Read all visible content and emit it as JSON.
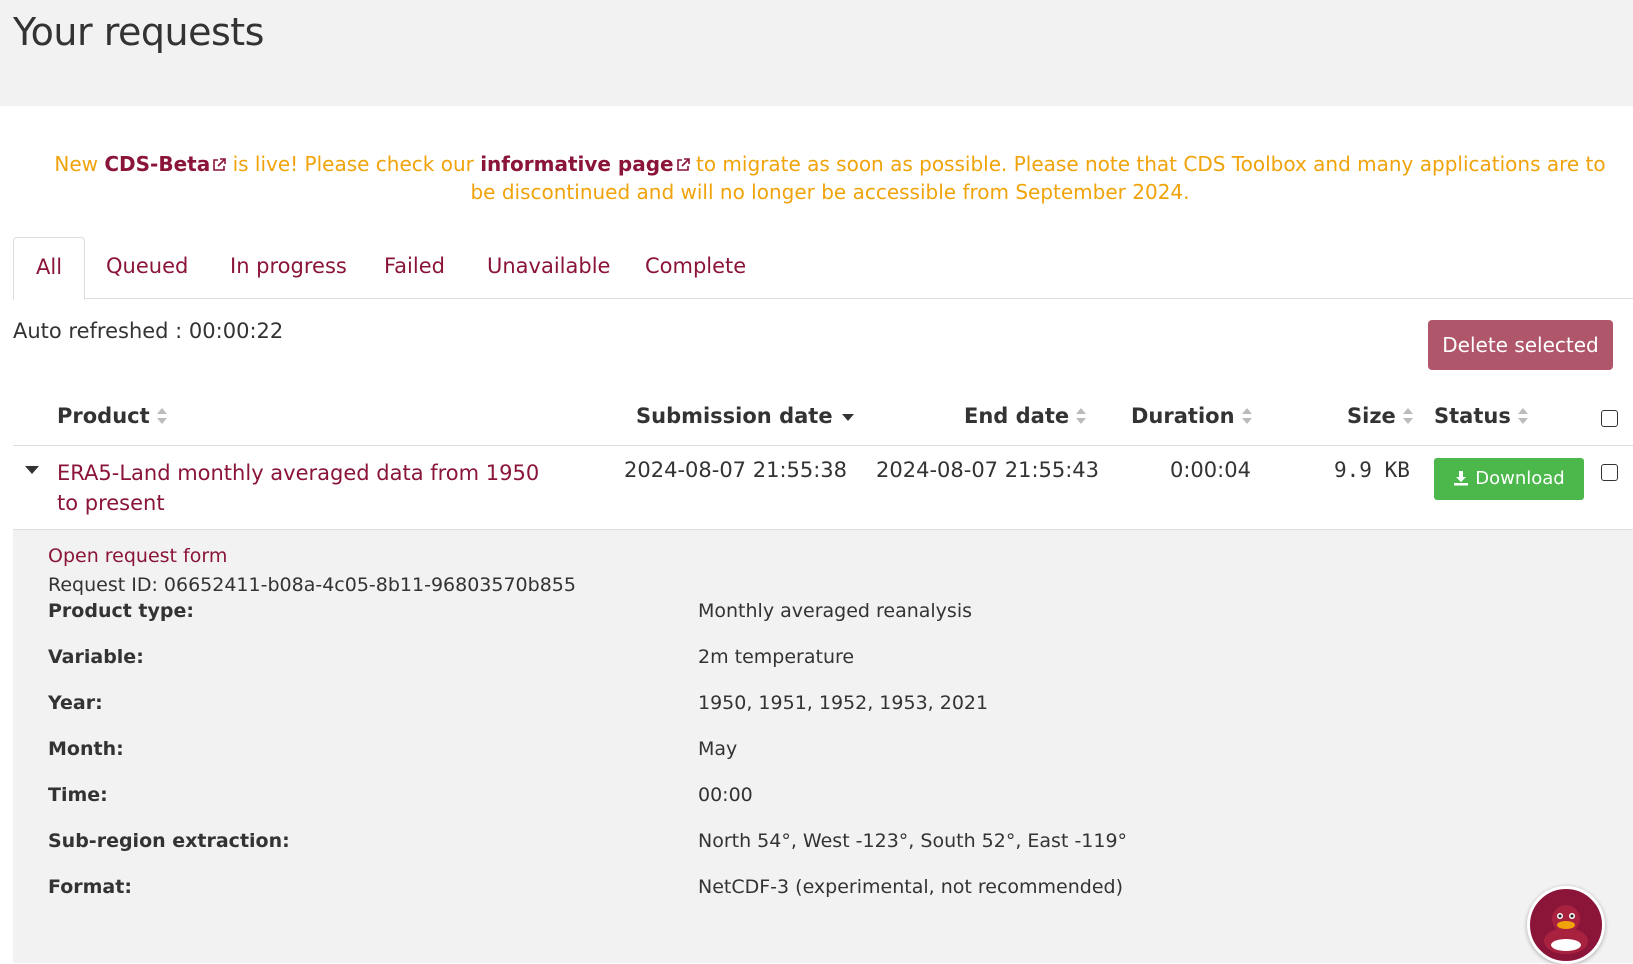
{
  "page": {
    "title": "Your requests"
  },
  "notice": {
    "prefix": "New ",
    "cds_beta_link": "CDS-Beta",
    "middle": " is live! Please check our ",
    "info_link": "informative page",
    "suffix": " to migrate as soon as possible. Please note that CDS Toolbox and many applications are to be discontinued and will no longer be accessible from September 2024."
  },
  "tabs": [
    {
      "label": "All",
      "active": true
    },
    {
      "label": "Queued"
    },
    {
      "label": "In progress"
    },
    {
      "label": "Failed"
    },
    {
      "label": "Unavailable"
    },
    {
      "label": "Complete"
    }
  ],
  "toolbar": {
    "auto_refresh": "Auto refreshed : 00:00:22",
    "delete_selected": "Delete selected"
  },
  "table": {
    "headers": {
      "product": "Product",
      "submission_date": "Submission date",
      "end_date": "End date",
      "duration": "Duration",
      "size": "Size",
      "status": "Status"
    },
    "rows": [
      {
        "product": "ERA5-Land monthly averaged data from 1950 to present",
        "submission_date": "2024-08-07 21:55:38",
        "end_date": "2024-08-07 21:55:43",
        "duration": "0:00:04",
        "size": "9.9 KB",
        "status_button": "Download"
      }
    ]
  },
  "details": {
    "open_request_form": "Open request form",
    "request_id": "Request ID: 06652411-b08a-4c05-8b11-96803570b855",
    "fields": [
      {
        "label": "Product type:",
        "value": "Monthly averaged reanalysis"
      },
      {
        "label": "Variable:",
        "value": "2m temperature"
      },
      {
        "label": "Year:",
        "value": "1950, 1951, 1952, 1953, 2021"
      },
      {
        "label": "Month:",
        "value": "May"
      },
      {
        "label": "Time:",
        "value": "00:00"
      },
      {
        "label": "Sub-region extraction:",
        "value": "North 54°, West -123°, South 52°, East -119°"
      },
      {
        "label": "Format:",
        "value": "NetCDF-3 (experimental, not recommended)"
      }
    ]
  },
  "colors": {
    "brand": "#8a1538",
    "notice": "#f0a30a",
    "download": "#4cb84c",
    "delete": "#b0566b"
  }
}
